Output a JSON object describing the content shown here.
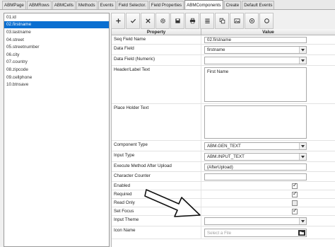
{
  "tabs": [
    "ABMPage",
    "ABMRows",
    "ABMCells",
    "Methods",
    "Events",
    "Field Selector.",
    "Field Properties",
    "ABMComponents",
    "Create",
    "Default Events"
  ],
  "active_tab": "ABMComponents",
  "field_list": [
    {
      "label": "01.id",
      "selected": false
    },
    {
      "label": "02.firstname",
      "selected": true
    },
    {
      "label": "03.lastname",
      "selected": false
    },
    {
      "label": "04.street",
      "selected": false
    },
    {
      "label": "05.streetnumber",
      "selected": false
    },
    {
      "label": "06.city",
      "selected": false
    },
    {
      "label": "07.country",
      "selected": false
    },
    {
      "label": "08.zipcode",
      "selected": false
    },
    {
      "label": "09.cellphone",
      "selected": false
    },
    {
      "label": "10.btnsave",
      "selected": false
    }
  ],
  "toolbar": [
    "plus-icon",
    "check-icon",
    "x-icon",
    "gear-icon",
    "save-icon",
    "print-icon",
    "list-icon",
    "copy-icon",
    "image-icon",
    "target-icon",
    "circle-icon"
  ],
  "grid": {
    "col_property": "Property",
    "col_value": "Value"
  },
  "properties": {
    "seq_field_name": {
      "label": "Seq Field Name",
      "value": "02.firstname"
    },
    "data_field": {
      "label": "Data Field",
      "value": "firstname"
    },
    "data_field_numeric": {
      "label": "Data Field (Numeric)",
      "value": ""
    },
    "header_label_text": {
      "label": "Header/Label Text",
      "value": "First Name"
    },
    "place_holder_text": {
      "label": "Place Holder Text",
      "value": ""
    },
    "component_type": {
      "label": "Component Type",
      "value": "ABM.GEN_TEXT"
    },
    "input_type": {
      "label": "Input Type",
      "value": "ABM.INPUT_TEXT"
    },
    "execute_after_upload": {
      "label": "Execute Method After Upload",
      "value": "(AfterUpload)"
    },
    "character_counter": {
      "label": "Character Counter",
      "value": ""
    },
    "enabled": {
      "label": "Enabled",
      "checked": true
    },
    "required": {
      "label": "Required",
      "checked": true
    },
    "read_only": {
      "label": "Read Only",
      "checked": false
    },
    "set_focus": {
      "label": "Set Focus",
      "checked": true
    },
    "input_theme": {
      "label": "Input Theme",
      "value": ""
    },
    "icon_name": {
      "label": "Icon Name",
      "placeholder": "Select a File"
    }
  }
}
